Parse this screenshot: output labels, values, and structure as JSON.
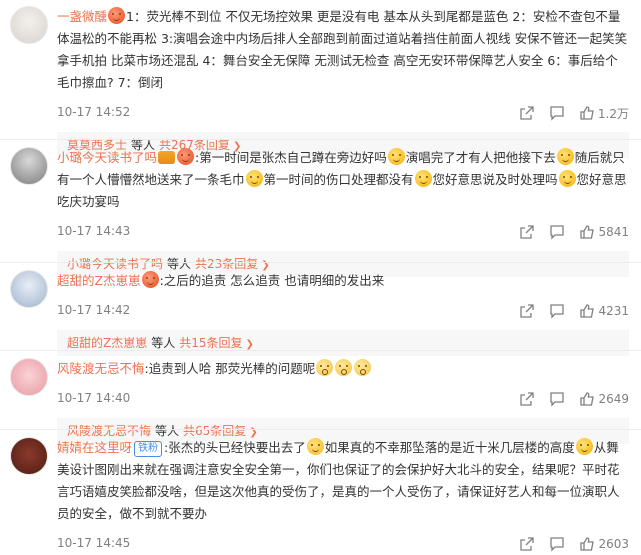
{
  "comments": [
    {
      "user": "一盏微醺",
      "emoji_after_name": "face-emoji",
      "text": "1：荧光棒不到位 不仅无场控效果 更是没有电 基本从头到尾都是蓝色 2：安检不查包不量体温松的不能再松 3:演唱会途中内场后排人全部跑到前面过道站着挡住前面人视线 安保不管还一起笑笑拿手机拍 比菜市场还混乱 4：舞台安全无保障 无测试无检查 高空无安环带保障艺人安全 6：事后给个毛巾擦血? 7：倒闭",
      "time": "10-17 14:52",
      "likes": "1.2万",
      "reply_user": "莫莫西多士",
      "reply_etc": "等人",
      "reply_total": "共267条回复"
    },
    {
      "user": "小璐今天读书了吗",
      "parts": [
        ":第一时间是张杰自己蹲在旁边好吗",
        "演唱完了才有人把他接下去",
        "随后就只有一个人懵懵然地送来了一条毛巾",
        "第一时间的伤口处理都没有",
        "您好意思说及时处理吗",
        "您好意思吃庆功宴吗"
      ],
      "time": "10-17 14:43",
      "likes": "5841",
      "reply_user": "小璐今天读书了吗",
      "reply_etc": "等人",
      "reply_total": "共23条回复"
    },
    {
      "user": "超甜的Z杰崽崽",
      "text": ":之后的追责 怎么追责 也请明细的发出来",
      "time": "10-17 14:42",
      "likes": "4231",
      "reply_user": "超甜的Z杰崽崽",
      "reply_etc": "等人",
      "reply_total": "共15条回复"
    },
    {
      "user": "风陵渡无忌不悔",
      "text": ":追责到人哈 那荧光棒的问题呢",
      "time": "10-17 14:40",
      "likes": "2649",
      "reply_user": "风陵渡无忌不悔",
      "reply_etc": "等人",
      "reply_total": "共65条回复"
    },
    {
      "user": "婧婧在这里呀",
      "badge": "铁粉",
      "parts": [
        ":张杰的头已经快要出去了",
        "如果真的不幸那坠落的是近十米几层楼的高度",
        "从舞美设计图刚出来就在强调注意安全安全第一，你们也保证了的会保护好大北斗的安全，结果呢？平时花言巧语嬉皮笑脸都没啥，但是这次他真的受伤了，是真的一个人受伤了，请保证好艺人和每一位演职人员的安全，做不到就不要办"
      ],
      "time": "10-17 14:45",
      "likes": "2603"
    }
  ],
  "colors": {
    "username": "#eb7350",
    "meta": "#808080",
    "reply_bg": "#f7f7f7"
  }
}
